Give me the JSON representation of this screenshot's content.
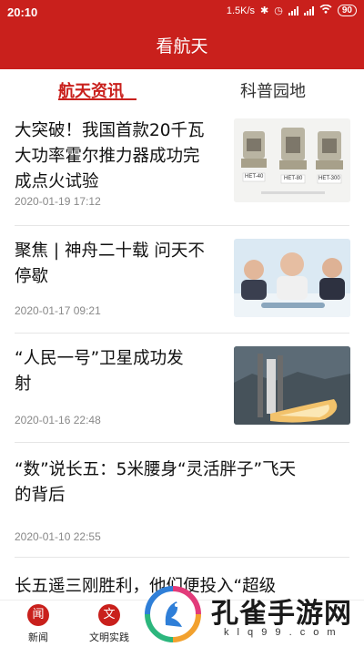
{
  "status": {
    "time": "20:10",
    "net_speed": "1.5K/s",
    "battery": "90"
  },
  "header": {
    "title": "看航天"
  },
  "tabs": [
    {
      "label": "航天资讯",
      "active": true
    },
    {
      "label": "科普园地",
      "active": false
    }
  ],
  "articles": [
    {
      "title_lines": [
        "大突破！我国首款20千瓦",
        "大功率霍尔推力器成功完",
        "成点火试验"
      ],
      "date": "2020-01-19 17:12",
      "thumb_captions": [
        "HET-40",
        "HET-80",
        "HET-300"
      ]
    },
    {
      "title_lines": [
        "聚焦 | 神舟二十载 问天不",
        "停歇"
      ],
      "date": "2020-01-17 09:21"
    },
    {
      "title_lines": [
        "“人民一号”卫星成功发",
        "射"
      ],
      "date": "2020-01-16 22:48"
    },
    {
      "title_lines": [
        "“数”说长五：5米腰身“灵活胖子”飞天",
        "的背后"
      ],
      "date": "2020-01-10 22:55"
    },
    {
      "title_lines": [
        "长五遥三刚胜利，他们便投入“超级"
      ],
      "date": ""
    }
  ],
  "bottom_nav": [
    {
      "label": "新闻",
      "icon": "news-icon"
    },
    {
      "label": "文明实践",
      "icon": "practice-icon"
    }
  ],
  "watermark": {
    "text": "孔雀手游网",
    "sub": "k l q 9 9 . c o m"
  },
  "colors": {
    "brand_red": "#c9201c"
  }
}
